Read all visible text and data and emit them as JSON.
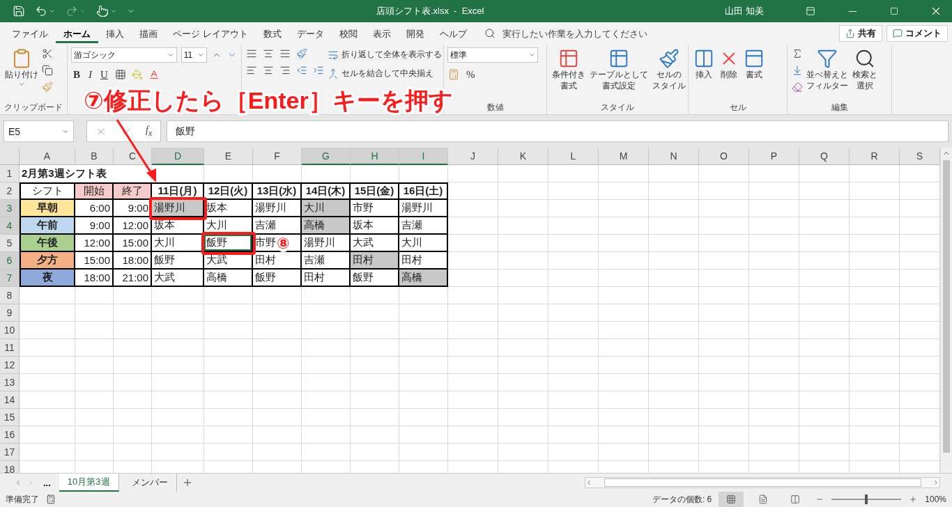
{
  "title_bar": {
    "title": "店頭シフト表.xlsx  -  Excel",
    "user": "山田 知美"
  },
  "ribbon_tabs": [
    {
      "label": "ファイル",
      "selected": false
    },
    {
      "label": "ホーム",
      "selected": true
    },
    {
      "label": "挿入",
      "selected": false
    },
    {
      "label": "描画",
      "selected": false
    },
    {
      "label": "ページ レイアウト",
      "selected": false
    },
    {
      "label": "数式",
      "selected": false
    },
    {
      "label": "データ",
      "selected": false
    },
    {
      "label": "校閲",
      "selected": false
    },
    {
      "label": "表示",
      "selected": false
    },
    {
      "label": "開発",
      "selected": false
    },
    {
      "label": "ヘルプ",
      "selected": false
    }
  ],
  "tell_me": {
    "placeholder": "実行したい作業を入力してください"
  },
  "share": "共有",
  "comment": "コメント",
  "ribbon": {
    "clipboard": {
      "paste": "貼り付け",
      "label": "クリップボード"
    },
    "font": {
      "name": "游ゴシック",
      "size": "11",
      "bold": "B",
      "italic": "I",
      "underline": "U"
    },
    "alignment": {
      "wrap": "折り返して全体を表示する",
      "merge": "セルを結合して中央揃え"
    },
    "number": {
      "format": "標準",
      "percent": "%",
      "label": "数値"
    },
    "styles": {
      "label": "スタイル",
      "buttons": [
        {
          "kind": "conditional",
          "lines": [
            "条件付き",
            "書式"
          ]
        },
        {
          "kind": "table",
          "lines": [
            "テーブルとして",
            "書式設定"
          ]
        },
        {
          "kind": "cellstyle",
          "lines": [
            "セルの",
            "スタイル"
          ]
        }
      ]
    },
    "cells": {
      "label": "セル",
      "buttons": [
        {
          "kind": "insert",
          "lines": [
            "挿入"
          ]
        },
        {
          "kind": "delete",
          "lines": [
            "削除"
          ]
        },
        {
          "kind": "format",
          "lines": [
            "書式"
          ]
        }
      ]
    },
    "editing": {
      "label": "編集",
      "buttons": [
        {
          "kind": "sort",
          "lines": [
            "並べ替えと",
            "フィルター"
          ]
        },
        {
          "kind": "find",
          "lines": [
            "検索と",
            "選択"
          ]
        }
      ]
    }
  },
  "formula_bar": {
    "name_box": "E5",
    "function_label": "f$_{x}$",
    "value": "飯野"
  },
  "sheet": {
    "columns": [
      {
        "label": "A",
        "selected": false
      },
      {
        "label": "B",
        "selected": false
      },
      {
        "label": "C",
        "selected": false
      },
      {
        "label": "D",
        "selected": true
      },
      {
        "label": "E",
        "selected": false
      },
      {
        "label": "F",
        "selected": false
      },
      {
        "label": "G",
        "selected": true
      },
      {
        "label": "H",
        "selected": true
      },
      {
        "label": "I",
        "selected": true
      },
      {
        "label": "J",
        "selected": false
      },
      {
        "label": "K",
        "selected": false
      },
      {
        "label": "L",
        "selected": false
      },
      {
        "label": "M",
        "selected": false
      },
      {
        "label": "N",
        "selected": false
      },
      {
        "label": "O",
        "selected": false
      },
      {
        "label": "P",
        "selected": false
      },
      {
        "label": "Q",
        "selected": false
      },
      {
        "label": "R",
        "selected": false
      },
      {
        "label": "S",
        "selected": false
      }
    ],
    "rows": [
      {
        "label": "1",
        "selected": false,
        "cells": [
          {
            "text": "2月第3週シフト表",
            "kind": "title"
          }
        ]
      },
      {
        "label": "2",
        "selected": false,
        "cells": [
          {
            "text": "シフト",
            "kind": "label"
          },
          {
            "text": "開始",
            "kind": "time-header"
          },
          {
            "text": "終了",
            "kind": "time-header"
          },
          {
            "text": "11日(月)",
            "kind": "day"
          },
          {
            "text": "12日(火)",
            "kind": "day"
          },
          {
            "text": "13日(水)",
            "kind": "day"
          },
          {
            "text": "14日(木)",
            "kind": "day"
          },
          {
            "text": "15日(金)",
            "kind": "day"
          },
          {
            "text": "16日(土)",
            "kind": "day"
          }
        ]
      },
      {
        "label": "3",
        "selected": true,
        "cells": [
          {
            "text": "早朝",
            "kind": "shift",
            "color": "#ffe699"
          },
          {
            "text": "6:00",
            "kind": "time"
          },
          {
            "text": "9:00",
            "kind": "time"
          },
          {
            "text": "湯野川",
            "kind": "name",
            "selected": true,
            "active": false,
            "highlighted": true
          },
          {
            "text": "坂本",
            "kind": "name",
            "selected": false,
            "active": false,
            "highlighted": false
          },
          {
            "text": "湯野川",
            "kind": "name",
            "selected": false,
            "active": false,
            "highlighted": false
          },
          {
            "text": "大川",
            "kind": "name",
            "selected": true,
            "active": false,
            "highlighted": false
          },
          {
            "text": "市野",
            "kind": "name",
            "selected": false,
            "active": false,
            "highlighted": false
          },
          {
            "text": "湯野川",
            "kind": "name",
            "selected": false,
            "active": false,
            "highlighted": false
          }
        ]
      },
      {
        "label": "4",
        "selected": true,
        "cells": [
          {
            "text": "午前",
            "kind": "shift",
            "color": "#bdd7ee"
          },
          {
            "text": "9:00",
            "kind": "time"
          },
          {
            "text": "12:00",
            "kind": "time"
          },
          {
            "text": "坂本",
            "kind": "name",
            "selected": false,
            "active": false,
            "highlighted": false
          },
          {
            "text": "大川",
            "kind": "name",
            "selected": false,
            "active": false,
            "highlighted": false
          },
          {
            "text": "吉瀬",
            "kind": "name",
            "selected": false,
            "active": false,
            "highlighted": false
          },
          {
            "text": "高橋",
            "kind": "name",
            "selected": true,
            "active": false,
            "highlighted": false
          },
          {
            "text": "坂本",
            "kind": "name",
            "selected": false,
            "active": false,
            "highlighted": false
          },
          {
            "text": "吉瀬",
            "kind": "name",
            "selected": false,
            "active": false,
            "highlighted": false
          }
        ]
      },
      {
        "label": "5",
        "selected": false,
        "cells": [
          {
            "text": "午後",
            "kind": "shift",
            "color": "#a9d08e"
          },
          {
            "text": "12:00",
            "kind": "time"
          },
          {
            "text": "15:00",
            "kind": "time"
          },
          {
            "text": "大川",
            "kind": "name",
            "selected": false,
            "active": false,
            "highlighted": false
          },
          {
            "text": "飯野",
            "kind": "name",
            "selected": false,
            "active": true,
            "highlighted": true
          },
          {
            "text": "市野",
            "kind": "name",
            "selected": false,
            "active": false,
            "highlighted": false,
            "badge": "⑧"
          },
          {
            "text": "湯野川",
            "kind": "name",
            "selected": false,
            "active": false,
            "highlighted": false
          },
          {
            "text": "大武",
            "kind": "name",
            "selected": false,
            "active": false,
            "highlighted": false
          },
          {
            "text": "大川",
            "kind": "name",
            "selected": false,
            "active": false,
            "highlighted": false
          }
        ]
      },
      {
        "label": "6",
        "selected": true,
        "cells": [
          {
            "text": "夕方",
            "kind": "shift",
            "color": "#f4b084"
          },
          {
            "text": "15:00",
            "kind": "time"
          },
          {
            "text": "18:00",
            "kind": "time"
          },
          {
            "text": "飯野",
            "kind": "name",
            "selected": false,
            "active": false,
            "highlighted": false
          },
          {
            "text": "大武",
            "kind": "name",
            "selected": false,
            "active": false,
            "highlighted": false
          },
          {
            "text": "田村",
            "kind": "name",
            "selected": false,
            "active": false,
            "highlighted": false
          },
          {
            "text": "吉瀬",
            "kind": "name",
            "selected": false,
            "active": false,
            "highlighted": false
          },
          {
            "text": "田村",
            "kind": "name",
            "selected": true,
            "active": false,
            "highlighted": false
          },
          {
            "text": "田村",
            "kind": "name",
            "selected": false,
            "active": false,
            "highlighted": false
          }
        ]
      },
      {
        "label": "7",
        "selected": true,
        "cells": [
          {
            "text": "夜",
            "kind": "shift",
            "color": "#8ea9db"
          },
          {
            "text": "18:00",
            "kind": "time"
          },
          {
            "text": "21:00",
            "kind": "time"
          },
          {
            "text": "大武",
            "kind": "name",
            "selected": false,
            "active": false,
            "highlighted": false
          },
          {
            "text": "高橋",
            "kind": "name",
            "selected": false,
            "active": false,
            "highlighted": false
          },
          {
            "text": "飯野",
            "kind": "name",
            "selected": false,
            "active": false,
            "highlighted": false
          },
          {
            "text": "田村",
            "kind": "name",
            "selected": false,
            "active": false,
            "highlighted": false
          },
          {
            "text": "飯野",
            "kind": "name",
            "selected": false,
            "active": false,
            "highlighted": false
          },
          {
            "text": "高橋",
            "kind": "name",
            "selected": true,
            "active": false,
            "highlighted": false
          }
        ]
      },
      {
        "label": "8",
        "selected": false
      },
      {
        "label": "9",
        "selected": false
      },
      {
        "label": "10",
        "selected": false
      },
      {
        "label": "11",
        "selected": false
      },
      {
        "label": "12",
        "selected": false
      },
      {
        "label": "13",
        "selected": false
      },
      {
        "label": "14",
        "selected": false
      },
      {
        "label": "15",
        "selected": false
      },
      {
        "label": "16",
        "selected": false
      },
      {
        "label": "17",
        "selected": false
      },
      {
        "label": "18",
        "selected": false
      }
    ]
  },
  "sheet_tabs": {
    "more": "...",
    "tabs": [
      {
        "label": "10月第3週",
        "selected": true
      },
      {
        "label": "メンバー",
        "selected": false
      }
    ]
  },
  "status_bar": {
    "status": "準備完了",
    "count": "データの個数: 6",
    "zoom": "100%",
    "zoom_slider": {
      "level": 0.5
    }
  },
  "annotation": {
    "callout": "⑦修正したら［Enter］キーを押す"
  }
}
